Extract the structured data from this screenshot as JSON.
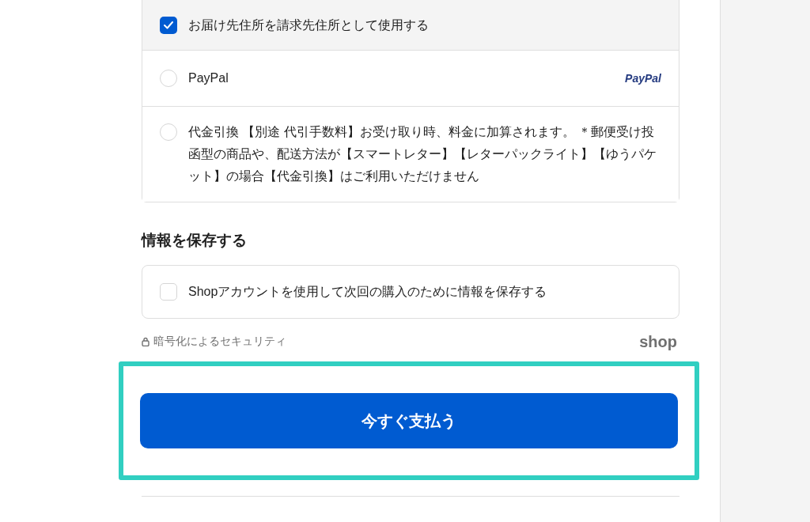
{
  "payment": {
    "billing_option": {
      "label": "お届け先住所を請求先住所として使用する",
      "checked": true
    },
    "methods": [
      {
        "label": "PayPal",
        "selected": false,
        "logo": "PayPal"
      },
      {
        "label": "代金引換 【別途 代引手数料】お受け取り時、料金に加算されます。 ＊郵便受け投函型の商品や、配送方法が【スマートレター】【レターパックライト】【ゆうパケット】の場合【代金引換】はご利用いただけません",
        "selected": false
      }
    ]
  },
  "save_info": {
    "heading": "情報を保存する",
    "option": {
      "label": "Shopアカウントを使用して次回の購入のために情報を保存する",
      "checked": false
    }
  },
  "security": {
    "label": "暗号化によるセキュリティ",
    "logo": "shop"
  },
  "pay_button": {
    "label": "今すぐ支払う",
    "highlighted": true
  }
}
